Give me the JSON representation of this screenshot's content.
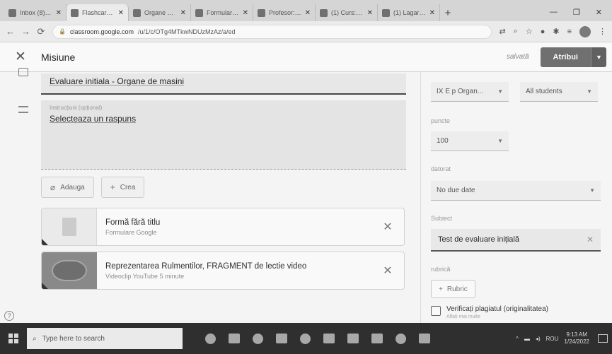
{
  "browser": {
    "tabs": [
      {
        "label": "Inbox (8) - yah...",
        "active": false
      },
      {
        "label": "Flashcards for D...",
        "active": true
      },
      {
        "label": "Organe de ma...",
        "active": false
      },
      {
        "label": "Formular fara ti...",
        "active": false
      },
      {
        "label": "Profesor: Admin",
        "active": false
      },
      {
        "label": "(1) Curs: ro lo...",
        "active": false
      },
      {
        "label": "(1) Lagare cu ru...",
        "active": false
      }
    ],
    "new_tab": "+",
    "window_controls": [
      "—",
      "❐",
      "✕"
    ],
    "url_host": "classroom.google.com",
    "url_path": "/u/1/c/OTg4MTkwNDUzMzAz/a/ed"
  },
  "header": {
    "title": "Misiune",
    "saved": "salvată",
    "assign_label": "Atribui"
  },
  "form": {
    "title_value": "Evaluare initiala -  Organe de masini",
    "instructions_label": "Instrucțiuni (opțional)",
    "instructions_value": "Selecteaza un raspuns",
    "add_label": "Adauga",
    "create_label": "Crea",
    "attachments": [
      {
        "title": "Formă fără titlu",
        "subtitle": "Formulare Google",
        "kind": "doc"
      },
      {
        "title": "Reprezentarea Rulmentilor, FRAGMENT de lectie video",
        "subtitle": "Videoclip YouTube 5 minute",
        "kind": "video"
      }
    ]
  },
  "sidebar": {
    "class_value": "IX E p Organ...",
    "students_value": "All students",
    "points_label": "puncte",
    "points_value": "100",
    "due_label": "datorat",
    "due_value": "No due date",
    "topic_label": "Subiect",
    "topic_value": "Test de evaluare inițială",
    "rubric_label": "rubrică",
    "rubric_button": "Rubric",
    "plagiarism_label": "Verificați plagiatul (originalitatea)",
    "plagiarism_sub": "Aflați mai multe"
  },
  "taskbar": {
    "search_placeholder": "Type here to search",
    "time": "9:13 AM",
    "date": "1/24/2022",
    "lang": "ROU"
  }
}
